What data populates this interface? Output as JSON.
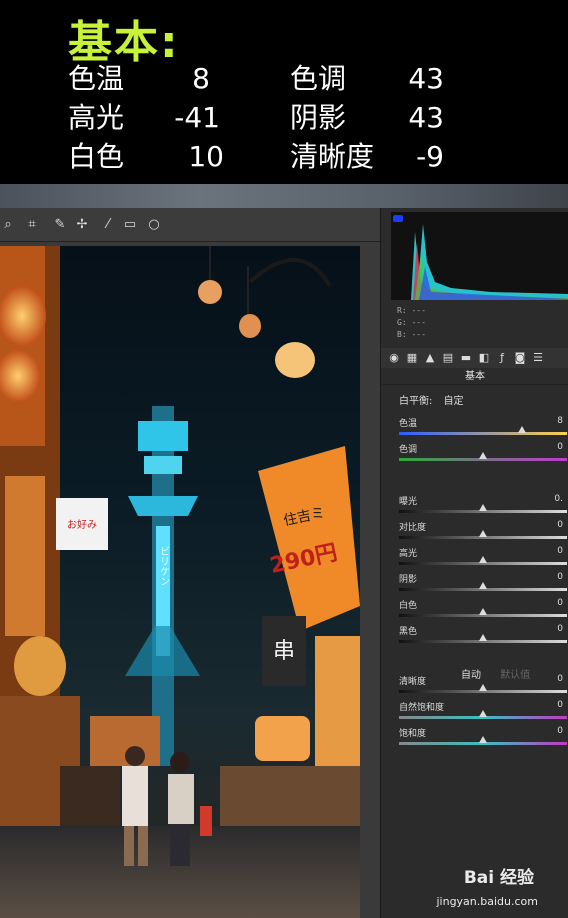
{
  "caption": {
    "title": "基本:",
    "rows": [
      {
        "l1": "色温",
        "v1": "8",
        "l2": "色调",
        "v2": "43"
      },
      {
        "l1": "高光",
        "v1": "-41",
        "l2": "阴影",
        "v2": "43"
      },
      {
        "l1": "白色",
        "v1": "10",
        "l2": "清晰度",
        "v2": "-9"
      }
    ]
  },
  "toolbar": {
    "icons": [
      "zoom-icon",
      "crop-icon",
      "eyedropper-icon",
      "spot-heal-icon",
      "brush-icon",
      "gradient-icon",
      "radial-icon"
    ]
  },
  "histogram": {
    "r_label": "R:",
    "g_label": "G:",
    "b_label": "B:",
    "r_value": "---",
    "g_value": "---",
    "b_value": "---"
  },
  "panel": {
    "title": "基本",
    "white_balance_label": "白平衡:",
    "white_balance_value": "自定",
    "auto_label": "自动",
    "default_label": "默认值",
    "adjustments": [
      {
        "label": "色温",
        "value": "8",
        "level": 0.73
      },
      {
        "label": "色调",
        "value": "0",
        "level": 0.5
      },
      {
        "label": "曝光",
        "value": "0.",
        "level": 0.5
      },
      {
        "label": "对比度",
        "value": "0",
        "level": 0.5
      },
      {
        "label": "高光",
        "value": "0",
        "level": 0.5
      },
      {
        "label": "阴影",
        "value": "0",
        "level": 0.5
      },
      {
        "label": "白色",
        "value": "0",
        "level": 0.5
      },
      {
        "label": "黑色",
        "value": "0",
        "level": 0.5
      },
      {
        "label": "清晰度",
        "value": "0",
        "level": 0.5
      },
      {
        "label": "自然饱和度",
        "value": "0",
        "level": 0.5
      },
      {
        "label": "饱和度",
        "value": "0",
        "level": 0.5
      }
    ]
  },
  "photo": {
    "sign_line1": "住吉ミ",
    "sign_line2": "290円",
    "sign_left": "お好み",
    "tower_text": "ビリケン",
    "sign_kanji": "串"
  },
  "watermark": {
    "brand": "Bai 经验",
    "url": "jingyan.baidu.com"
  },
  "colors": {
    "caption_title": "#c6f23a",
    "panel_bg": "#2b2b2b",
    "temp_track_left": "#2c5cff",
    "temp_track_right": "#ffd24a",
    "tint_track_left": "#2eaa3a",
    "tint_track_right": "#c23ad0"
  }
}
